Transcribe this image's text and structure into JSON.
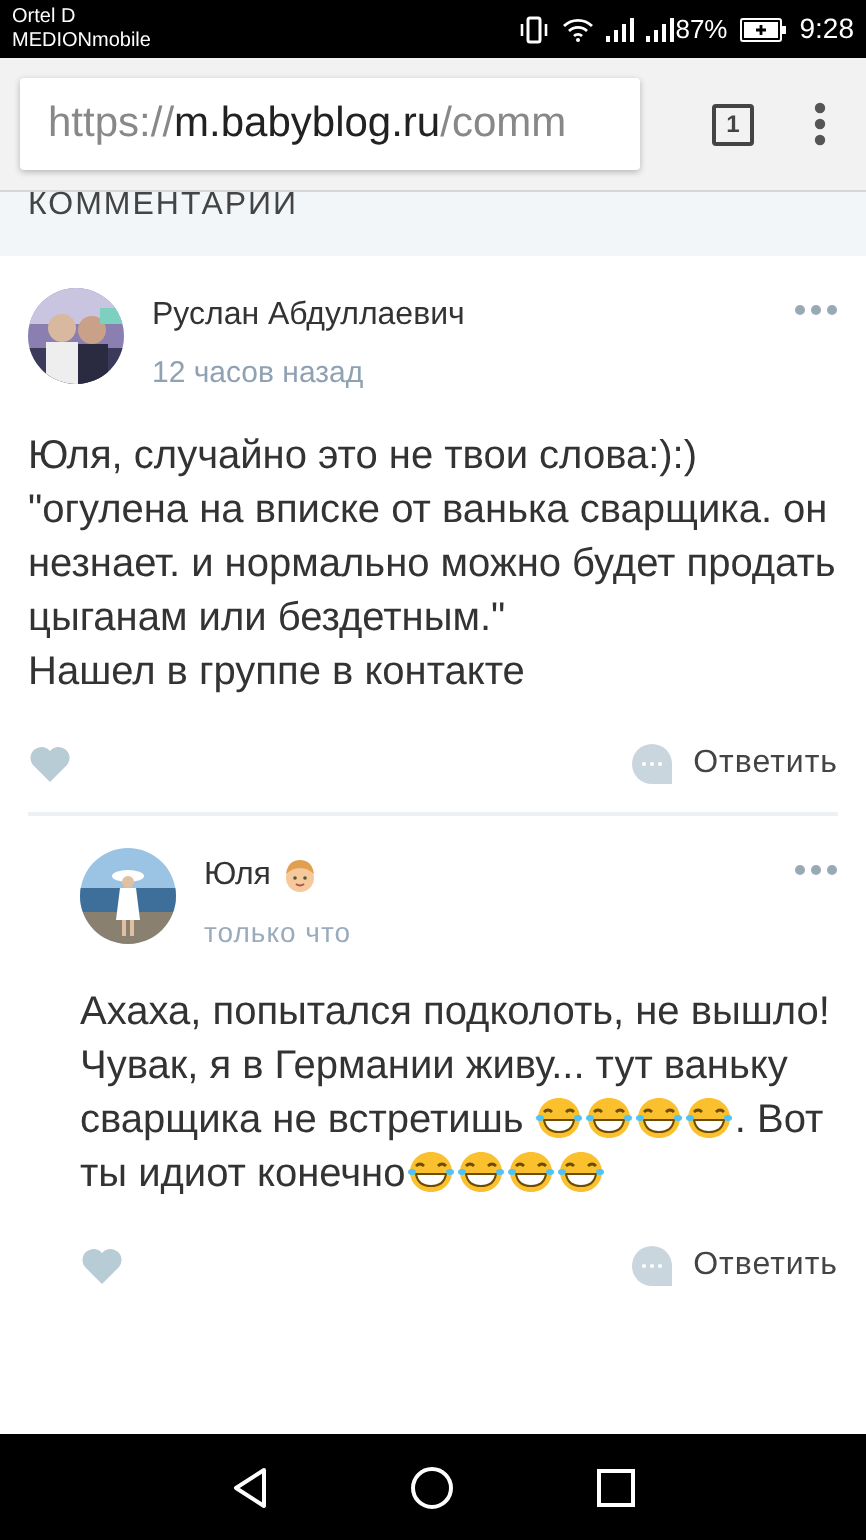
{
  "status_bar": {
    "carrier": "Ortel D",
    "operator": "MEDIONmobile",
    "battery": "87%",
    "time": "9:28"
  },
  "browser": {
    "url_scheme": "https://",
    "url_host": "m.babyblog.ru",
    "url_path": "/comm",
    "tab_count": "1"
  },
  "section_title": "КОММЕНТАРИИ",
  "comments": [
    {
      "author": "Руслан Абдуллаевич",
      "time": "12 часов назад",
      "verified_badge": false,
      "liked": false,
      "reply": "Ответить",
      "body": [
        {
          "kind": "text",
          "text": "Юля, случайно это не твои слова:):)\n\"огулена на вписке от ванька сварщика. он незнает. и нормально можно будет продать цыганам или бездетным.\"\nНашел в группе в контакте"
        }
      ],
      "replies": [
        {
          "author": "Юля",
          "time": "только что",
          "verified_badge": true,
          "liked": false,
          "reply": "Ответить",
          "body": [
            {
              "kind": "text",
              "text": "Ахаха, попытался подколоть, не вышло! Чувак, я в Германии живу... тут ваньку сварщика не встретишь "
            },
            {
              "kind": "emoji"
            },
            {
              "kind": "emoji"
            },
            {
              "kind": "emoji"
            },
            {
              "kind": "emoji"
            },
            {
              "kind": "text",
              "text": ". Вот ты идиот конечно"
            },
            {
              "kind": "emoji"
            },
            {
              "kind": "emoji"
            },
            {
              "kind": "emoji"
            },
            {
              "kind": "emoji"
            }
          ]
        }
      ]
    }
  ]
}
